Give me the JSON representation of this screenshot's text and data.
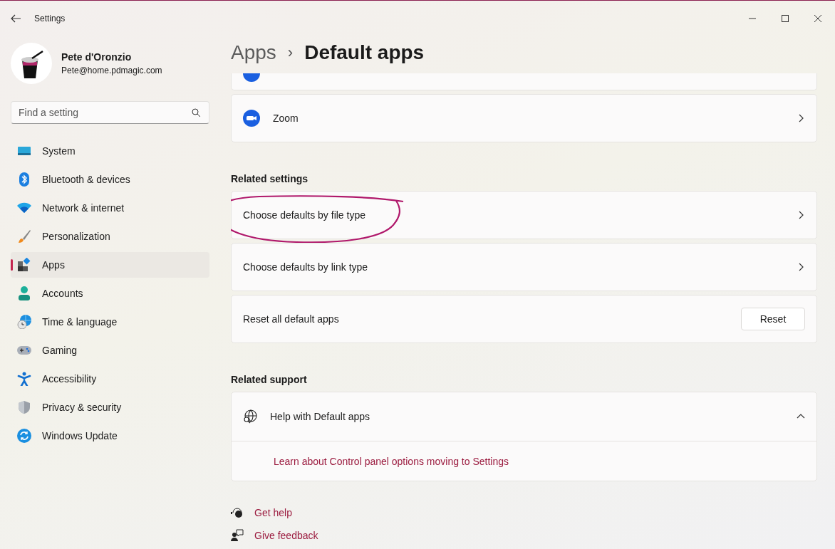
{
  "window": {
    "title": "Settings"
  },
  "account": {
    "name": "Pete d'Oronzio",
    "email": "Pete@home.pdmagic.com"
  },
  "search": {
    "placeholder": "Find a setting"
  },
  "nav": [
    {
      "label": "System",
      "selected": false
    },
    {
      "label": "Bluetooth & devices",
      "selected": false
    },
    {
      "label": "Network & internet",
      "selected": false
    },
    {
      "label": "Personalization",
      "selected": false
    },
    {
      "label": "Apps",
      "selected": true
    },
    {
      "label": "Accounts",
      "selected": false
    },
    {
      "label": "Time & language",
      "selected": false
    },
    {
      "label": "Gaming",
      "selected": false
    },
    {
      "label": "Accessibility",
      "selected": false
    },
    {
      "label": "Privacy & security",
      "selected": false
    },
    {
      "label": "Windows Update",
      "selected": false
    }
  ],
  "breadcrumb": {
    "parent": "Apps",
    "separator": "›",
    "current": "Default apps"
  },
  "apps": [
    {
      "kind": "cut"
    },
    {
      "kind": "app",
      "name": "Zoom"
    }
  ],
  "related_settings": {
    "heading": "Related settings",
    "items": [
      {
        "kind": "link",
        "label": "Choose defaults by file type",
        "annotated": true
      },
      {
        "kind": "link",
        "label": "Choose defaults by link type",
        "annotated": false
      },
      {
        "kind": "button",
        "label": "Reset all default apps",
        "button": "Reset",
        "annotated": false
      }
    ]
  },
  "related_support": {
    "heading": "Related support",
    "title": "Help with Default apps",
    "expanded": true,
    "links": [
      "Learn about Control panel options moving to Settings"
    ]
  },
  "footer_links": [
    {
      "label": "Get help"
    },
    {
      "label": "Give feedback"
    }
  ]
}
